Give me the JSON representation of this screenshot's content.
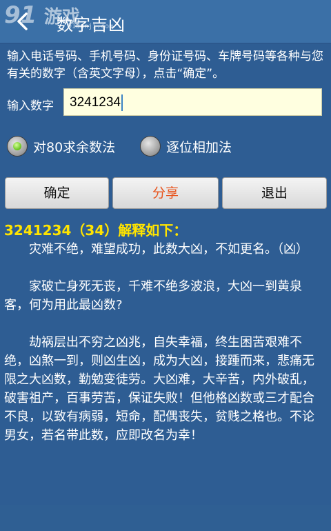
{
  "header": {
    "title": "数字吉凶",
    "watermark": {
      "logo": "91",
      "text": "游戏",
      "url": "91danji.com"
    }
  },
  "description": "输入电话号码、手机号码、身份证号码、车牌号码等各种与您有关的数字（含英文字母），点击“确定”。",
  "input": {
    "label": "输入数字",
    "value": "3241234"
  },
  "modes": {
    "option1": {
      "label": "对80求余数法",
      "selected": true
    },
    "option2": {
      "label": "逐位相加法",
      "selected": false
    }
  },
  "buttons": {
    "confirm": "确定",
    "share": "分享",
    "exit": "退出"
  },
  "colors": {
    "background": "#2e5d93",
    "result_title": "#ffe400",
    "share_text": "#e8541d",
    "input_bg": "#ffffe0"
  },
  "result": {
    "title": "3241234（34）解释如下：",
    "paragraphs": [
      "灾难不绝，难望成功，此数大凶，不如更名。（凶）",
      "家破亡身死无丧，千难不绝多波浪，大凶一到黄泉客，何为用此最凶数?",
      "劫祸层出不穷之凶兆，自失幸福，终生困苦艰难不绝，凶煞一到，则凶生凶，成为大凶，接踵而来，悲痛无限之大凶数，勤勉变徒劳。大凶难，大辛苦，内外破乱，破害祖产，百事劳苦，保证失败！但他格凶数或三才配合不良，以致有病弱，短命，配偶丧失，贫贱之格也。不论男女，若名带此数，应即改名为幸！"
    ]
  }
}
